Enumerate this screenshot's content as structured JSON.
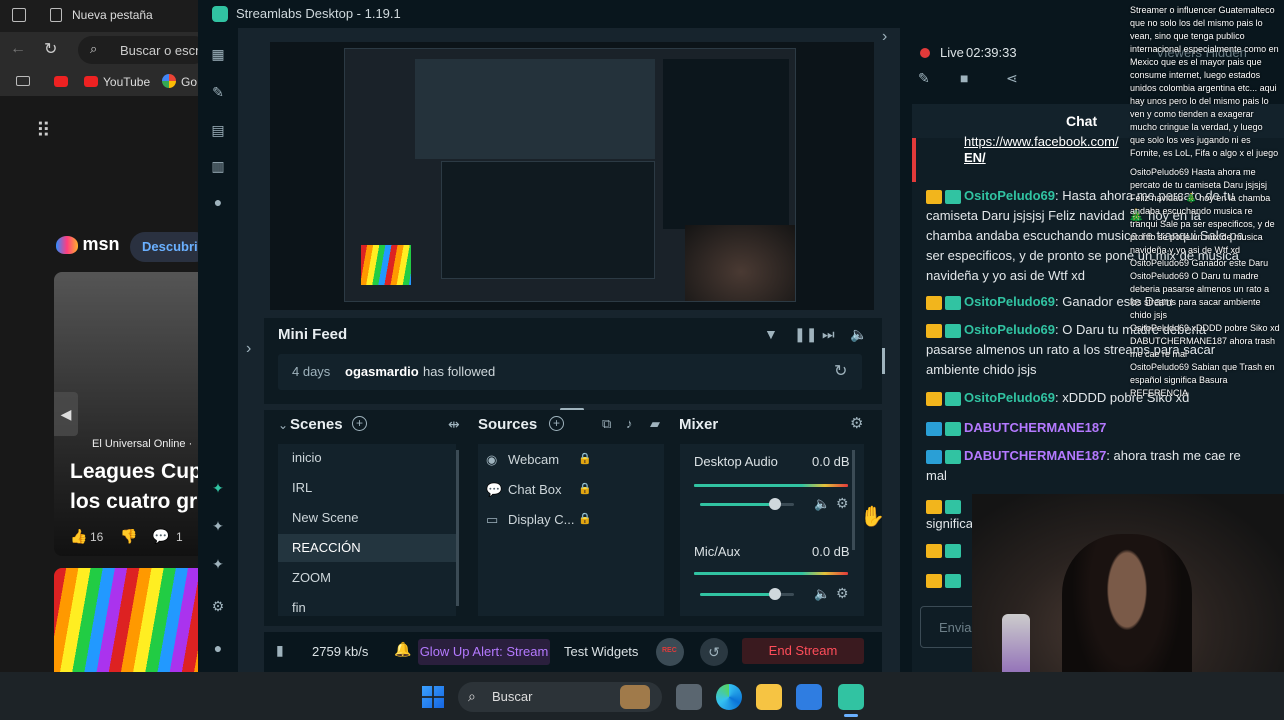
{
  "browser": {
    "tab_title": "Nueva pestaña",
    "search_placeholder": "Buscar o escr",
    "bookmarks": [
      {
        "label": ""
      },
      {
        "label": "YouTube"
      },
      {
        "label": "Go"
      }
    ],
    "msn_logo": "msn",
    "discover_button": "Descubrir",
    "news_source": "El Universal Online ·",
    "news_headline_line1": "Leagues Cup",
    "news_headline_line2": "los cuatro gr",
    "likes_count": "16",
    "comments_count": "1"
  },
  "streamlabs": {
    "app_title": "Streamlabs Desktop - 1.19.1",
    "minifeed": {
      "title": "Mini Feed",
      "event_time": "4 days",
      "event_user": "ogasmardio",
      "event_action": "has followed"
    },
    "scenes": {
      "title": "Scenes",
      "items": [
        "inicio",
        "IRL",
        "New Scene",
        "REACCIÓN",
        "ZOOM",
        "fin"
      ],
      "active_index": 3
    },
    "sources": {
      "title": "Sources",
      "items": [
        {
          "label": "Webcam",
          "icon": "camera-icon"
        },
        {
          "label": "Chat Box",
          "icon": "chat-icon"
        },
        {
          "label": "Display C...",
          "icon": "monitor-icon"
        }
      ]
    },
    "mixer": {
      "title": "Mixer",
      "channels": [
        {
          "name": "Desktop Audio",
          "level": "0.0 dB",
          "volume": 0.8
        },
        {
          "name": "Mic/Aux",
          "level": "0.0 dB",
          "volume": 0.8
        }
      ]
    },
    "bottombar": {
      "bitrate": "2759 kb/s",
      "alert_label": "Glow Up Alert: Stream",
      "test_widgets": "Test Widgets",
      "rec_label": "REC",
      "end_stream": "End Stream"
    },
    "live": {
      "status": "Live",
      "timer": "02:39:33",
      "viewers": "Viewers Hidden"
    },
    "chat": {
      "title": "Chat",
      "link_text_1": "https://www.facebook.com/",
      "link_text_2": "EN/",
      "messages": [
        {
          "user": "OsitoPeludo69",
          "text": ": Hasta ahora me percato de tu camiseta Daru jsjsjsj Feliz navidad 🎄 hoy en la chamba andaba escuchando musica re tranqui Sale pa ser especificos, y de pronto se pone un mix de musica navideña y yo asi de Wtf xd"
        },
        {
          "user": "OsitoPeludo69",
          "text": ": Ganador este Daru"
        },
        {
          "user": "OsitoPeludo69",
          "text": ": O Daru tu madre deberia pasarse almenos un rato a los streams para sacar ambiente chido jsjs"
        },
        {
          "user": "OsitoPeludo69",
          "text": ": xDDDD pobre Siko xd"
        },
        {
          "user": "DABUTCHERMANE187",
          "text": ""
        },
        {
          "user": "DABUTCHERMANE187",
          "text": ": ahora trash me cae re mal"
        }
      ],
      "partial_text": "significa",
      "input_placeholder": "Envia"
    }
  },
  "overlay_chat": {
    "text": "Streamer o influencer Guatemalteco que no solo los del mismo pais lo vean, sino que tenga publico internacional especialmente como en Mexico que es el mayor pais que consume internet, luego estados unidos colombia argentina etc... aqui hay unos pero lo del mismo pais lo ven y como tienden a exagerar mucho cringue la verdad, y luego que solo los ves jugando ni es Fornite, es LoL, Fifa o algo x el juego",
    "lines": [
      "OsitoPeludo69  Hasta ahora me percato de tu camiseta Daru jsjsjsj Feliz navidad 🎄 hoy en la chamba andaba escuchando musica re tranqui Sale pa ser especificos, y de pronto se pone un mix de musica navideña y yo asi de Wtf xd",
      "OsitoPeludo69  Ganador este Daru",
      "OsitoPeludo69  O Daru tu madre deberia pasarse almenos un rato a los streams para sacar ambiente chido jsjs",
      "OsitoPeludo69  xDDDD pobre Siko xd",
      "DABUTCHERMANE187  ahora trash me cae re mal",
      "OsitoPeludo69  Sabian que Trash en español significa Basura",
      "REFERENCIA"
    ]
  },
  "taskbar": {
    "search_label": "Buscar"
  }
}
